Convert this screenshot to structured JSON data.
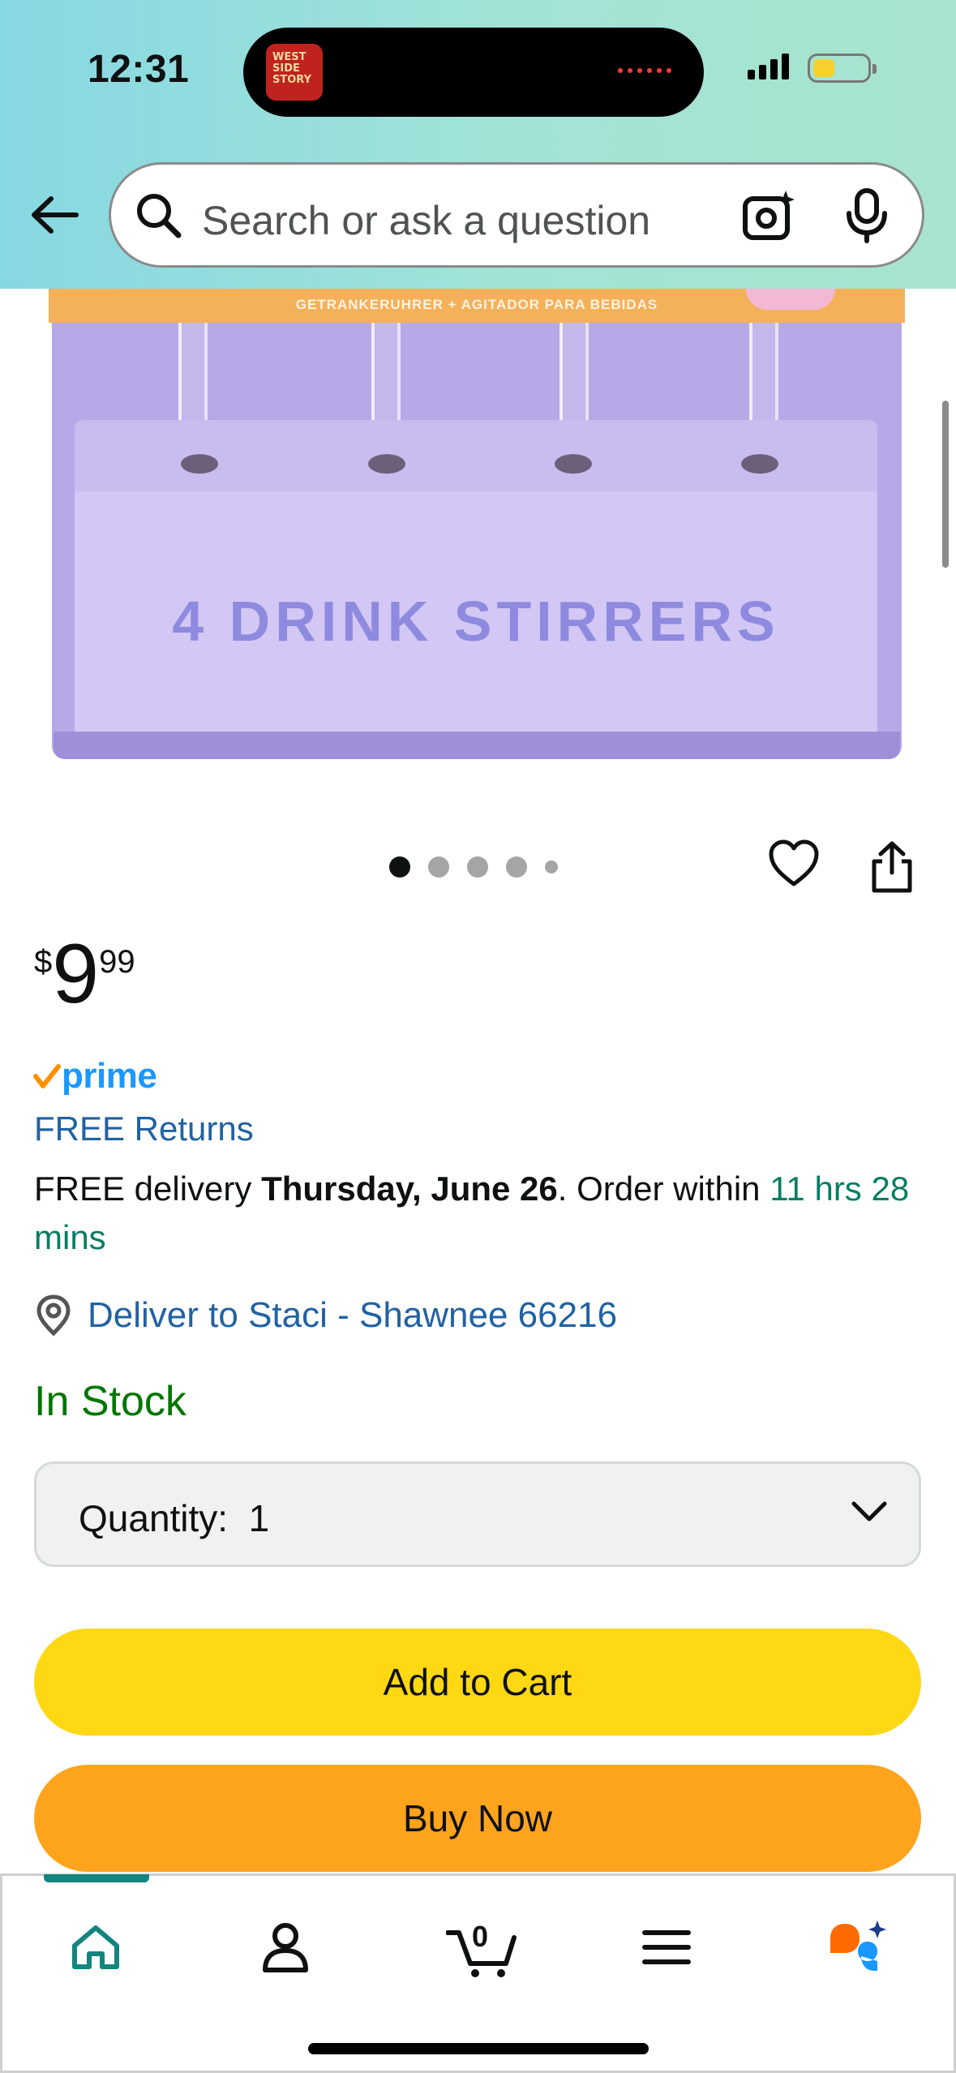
{
  "status_bar": {
    "time": "12:31"
  },
  "search": {
    "placeholder": "Search or ask a question"
  },
  "product_image": {
    "band_text": "GETRANKERUHRER + AGITADOR PARA BEBIDAS",
    "box_title": "4 DRINK STIRRERS",
    "carousel_total": 5,
    "carousel_active": 1
  },
  "price": {
    "symbol": "$",
    "whole": "9",
    "fraction": "99"
  },
  "prime": {
    "label": "prime"
  },
  "free_returns": "FREE Returns",
  "delivery": {
    "prefix": "FREE delivery ",
    "date": "Thursday, June 26",
    "middle": ". Order within ",
    "countdown": "11 hrs 28 mins"
  },
  "deliver_to": "Deliver to Staci - Shawnee 66216",
  "stock_status": "In Stock",
  "quantity": {
    "label": "Quantity:",
    "value": "1"
  },
  "buttons": {
    "add_to_cart": "Add to Cart",
    "buy_now": "Buy Now"
  },
  "bottom_nav": {
    "cart_count": "0",
    "active_tab": "home"
  },
  "colors": {
    "prime_blue": "#1a98ff",
    "link_blue": "#2162a1",
    "stock_green": "#007600",
    "add_to_cart": "#ffd814",
    "buy_now": "#ffa41c"
  }
}
